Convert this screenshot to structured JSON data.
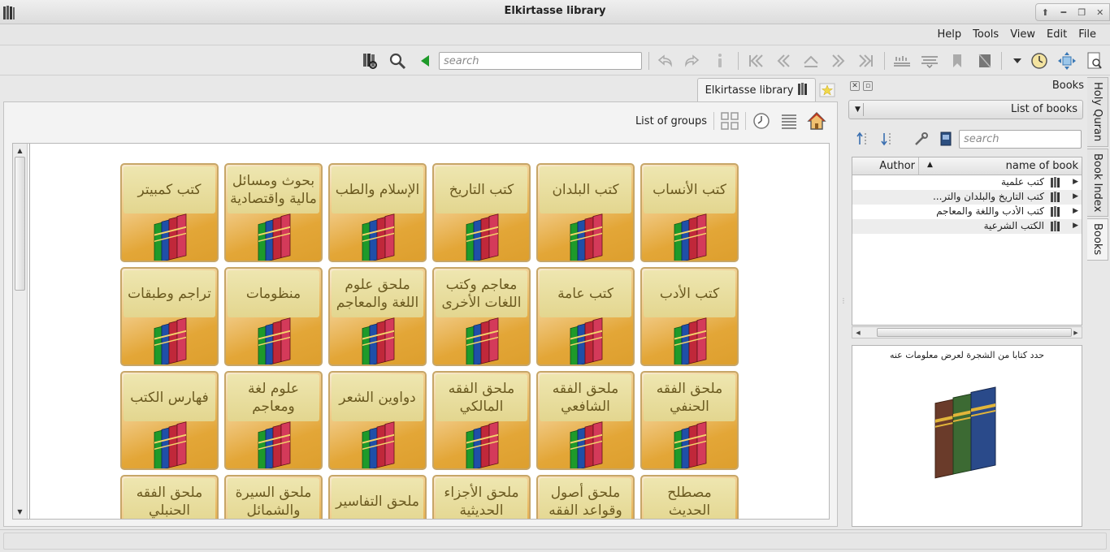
{
  "window": {
    "title": "Elkirtasse library",
    "controls": [
      "up",
      "minimize",
      "restore",
      "close"
    ]
  },
  "menubar": {
    "items": [
      {
        "label": "Help"
      },
      {
        "label": "Tools"
      },
      {
        "label": "View"
      },
      {
        "label": "Edit"
      },
      {
        "label": "File"
      }
    ]
  },
  "toolbar": {
    "search_placeholder": "search",
    "icons": [
      "library-icon",
      "zoom-icon",
      "back-green-icon",
      "undo-icon",
      "redo-icon",
      "info-icon",
      "first-page-icon",
      "prev-page-icon",
      "up-page-icon",
      "next-page-icon",
      "last-page-icon",
      "text-icon-1",
      "text-icon-2",
      "bookmark-icon",
      "page-icon",
      "dropdown-icon",
      "history-icon",
      "fit-icon",
      "settings-icon"
    ]
  },
  "main": {
    "tab_label": "Elkirtasse library",
    "groups_label": "List of groups",
    "tiles": [
      [
        "كتب الأنساب",
        "كتب البلدان",
        "كتب التاريخ",
        "الإسلام والطب",
        "بحوث ومسائل مالية واقتصادية",
        "كتب كمبيتر"
      ],
      [
        "كتب الأدب",
        "كتب عامة",
        "معاجم وكتب اللغات الأخرى",
        "ملحق علوم اللغة والمعاجم",
        "منظومات",
        "تراجم وطبقات"
      ],
      [
        "ملحق الفقه الحنفي",
        "ملحق الفقه الشافعي",
        "ملحق الفقه المالكي",
        "دواوين الشعر",
        "علوم لغة ومعاجم",
        "فهارس الكتب"
      ],
      [
        "مصطلح الحديث",
        "ملحق أصول وقواعد الفقه",
        "ملحق الأجزاء الحديثية",
        "ملحق التفاسير",
        "ملحق السيرة والشمائل",
        "ملحق الفقه الحنبلي"
      ]
    ]
  },
  "dock": {
    "title": "Books",
    "list_label": "List of books",
    "search_placeholder": "search",
    "col_author": "Author",
    "col_name": "name of book",
    "rows": [
      {
        "label": "كتب علمية"
      },
      {
        "label": "كتب التاريخ والبلدان والتر..."
      },
      {
        "label": "كتب الأدب واللغة والمعاجم"
      },
      {
        "label": "الكتب الشرعية"
      }
    ],
    "info_text": "حدد كتابا من الشجرة لعرض معلومات عنه"
  },
  "side_tabs": [
    {
      "label": "Holy Quran"
    },
    {
      "label": "Book Index"
    },
    {
      "label": "Books"
    }
  ],
  "colors": {
    "tile_gold": "#e3a637",
    "tile_label": "#e3d68f",
    "tile_text": "#6b5a20"
  }
}
